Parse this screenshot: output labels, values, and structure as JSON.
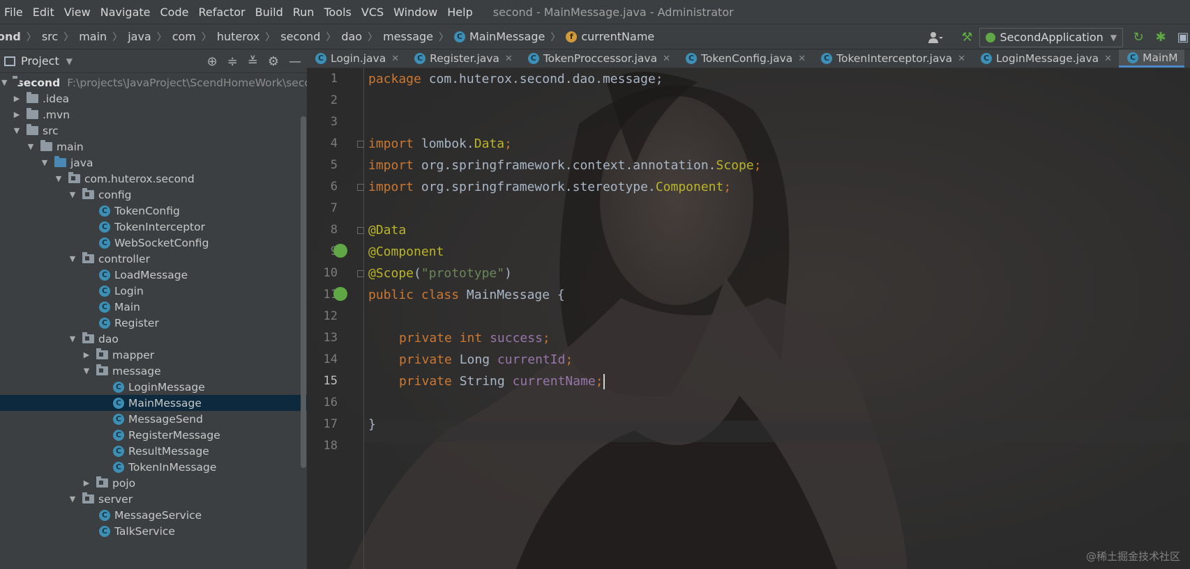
{
  "menu": [
    "File",
    "Edit",
    "View",
    "Navigate",
    "Code",
    "Refactor",
    "Build",
    "Run",
    "Tools",
    "VCS",
    "Window",
    "Help"
  ],
  "window_title": "second - MainMessage.java - Administrator",
  "breadcrumbs": [
    "ond",
    "src",
    "main",
    "java",
    "com",
    "huterox",
    "second",
    "dao",
    "message",
    "MainMessage",
    "currentName"
  ],
  "run_config": "SecondApplication",
  "project_header": "Project",
  "tree": [
    {
      "label": "second",
      "extra": "F:\\projects\\JavaProject\\ScendHomeWork\\second"
    },
    {
      "label": ".idea"
    },
    {
      "label": ".mvn"
    },
    {
      "label": "src"
    },
    {
      "label": "main"
    },
    {
      "label": "java"
    },
    {
      "label": "com.huterox.second"
    },
    {
      "label": "config"
    },
    {
      "label": "TokenConfig"
    },
    {
      "label": "TokenInterceptor"
    },
    {
      "label": "WebSocketConfig"
    },
    {
      "label": "controller"
    },
    {
      "label": "LoadMessage"
    },
    {
      "label": "Login"
    },
    {
      "label": "Main"
    },
    {
      "label": "Register"
    },
    {
      "label": "dao"
    },
    {
      "label": "mapper"
    },
    {
      "label": "message"
    },
    {
      "label": "LoginMessage"
    },
    {
      "label": "MainMessage"
    },
    {
      "label": "MessageSend"
    },
    {
      "label": "RegisterMessage"
    },
    {
      "label": "ResultMessage"
    },
    {
      "label": "TokenInMessage"
    },
    {
      "label": "pojo"
    },
    {
      "label": "server"
    },
    {
      "label": "MessageService"
    },
    {
      "label": "TalkService"
    }
  ],
  "tabs": [
    "Login.java",
    "Register.java",
    "TokenProccessor.java",
    "TokenConfig.java",
    "TokenInterceptor.java",
    "LoginMessage.java",
    "MainM"
  ],
  "code": {
    "line_numbers": [
      "1",
      "2",
      "3",
      "4",
      "5",
      "6",
      "7",
      "8",
      "9",
      "10",
      "11",
      "12",
      "13",
      "14",
      "15",
      "16",
      "17",
      "18"
    ],
    "l1": {
      "kw": "package",
      "rest": " com.huterox.second.dao.message;"
    },
    "l4": {
      "kw": "import",
      "rest": " lombok.",
      "cls": "Data",
      ";": ";"
    },
    "l5": {
      "kw": "import",
      "rest": " org.springframework.context.annotation.",
      "cls": "Scope"
    },
    "l6": {
      "kw": "import",
      "rest": " org.springframework.stereotype.",
      "cls": "Component"
    },
    "l8": "@Data",
    "l9": "@Component",
    "l10": {
      "ann": "@Scope",
      "open": "(",
      "str": "\"prototype\"",
      "close": ")"
    },
    "l11": {
      "kw": "public class",
      "rest": " MainMessage {"
    },
    "l13": {
      "kw": "private int",
      "fld": "success"
    },
    "l14": {
      "kw": "private",
      "type": " Long ",
      "fld": "currentId"
    },
    "l15": {
      "kw": "private",
      "type": " String ",
      "fld": "currentName"
    },
    "l17": "}",
    "semi": ";"
  },
  "watermark": "@稀土掘金技术社区",
  "colors": {
    "keyword": "#cc7832",
    "annotation": "#bbb529",
    "string": "#6a8759",
    "field": "#9876aa",
    "text": "#a9b7c6"
  }
}
